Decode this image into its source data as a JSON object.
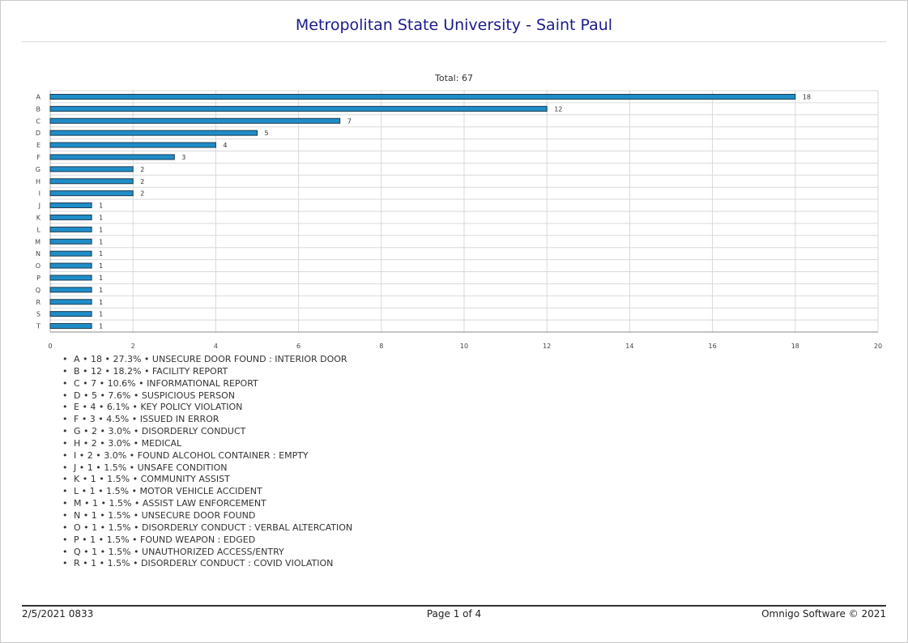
{
  "report": {
    "title": "Metropolitan State University - Saint Paul",
    "footer_left": "2/5/2021 0833",
    "footer_center": "Page 1 of 4",
    "footer_right": "Omnigo Software © 2021"
  },
  "chart_data": {
    "type": "bar",
    "orientation": "horizontal",
    "title": "Total: 67",
    "categories": [
      "A",
      "B",
      "C",
      "D",
      "E",
      "F",
      "G",
      "H",
      "I",
      "J",
      "K",
      "L",
      "M",
      "N",
      "O",
      "P",
      "Q",
      "R",
      "S",
      "T"
    ],
    "values": [
      18,
      12,
      7,
      5,
      4,
      3,
      2,
      2,
      2,
      1,
      1,
      1,
      1,
      1,
      1,
      1,
      1,
      1,
      1,
      1
    ],
    "xlim": [
      0,
      20
    ],
    "xticks": [
      0,
      2,
      4,
      6,
      8,
      10,
      12,
      14,
      16,
      18,
      20
    ],
    "grid": true,
    "bar_color": "#1f8dc8",
    "bar_edge_color": "#1b3a4f"
  },
  "legend": [
    "A • 18 • 27.3% • UNSECURE DOOR FOUND : INTERIOR DOOR",
    "B • 12 • 18.2% • FACILITY REPORT",
    "C • 7 • 10.6% • INFORMATIONAL REPORT",
    "D • 5 • 7.6% • SUSPICIOUS PERSON",
    "E • 4 • 6.1% • KEY POLICY VIOLATION",
    "F • 3 • 4.5% • ISSUED IN ERROR",
    "G • 2 • 3.0% • DISORDERLY CONDUCT",
    "H • 2 • 3.0% • MEDICAL",
    "I • 2 • 3.0% • FOUND ALCOHOL CONTAINER : EMPTY",
    "J • 1 • 1.5% • UNSAFE CONDITION",
    "K • 1 • 1.5% • COMMUNITY ASSIST",
    "L • 1 • 1.5% • MOTOR VEHICLE ACCIDENT",
    "M • 1 • 1.5% • ASSIST LAW ENFORCEMENT",
    "N • 1 • 1.5% • UNSECURE DOOR FOUND",
    "O • 1 • 1.5% • DISORDERLY CONDUCT : VERBAL ALTERCATION",
    "P • 1 • 1.5% • FOUND WEAPON : EDGED",
    "Q • 1 • 1.5% • UNAUTHORIZED ACCESS/ENTRY",
    "R • 1 • 1.5% • DISORDERLY CONDUCT : COVID VIOLATION"
  ]
}
